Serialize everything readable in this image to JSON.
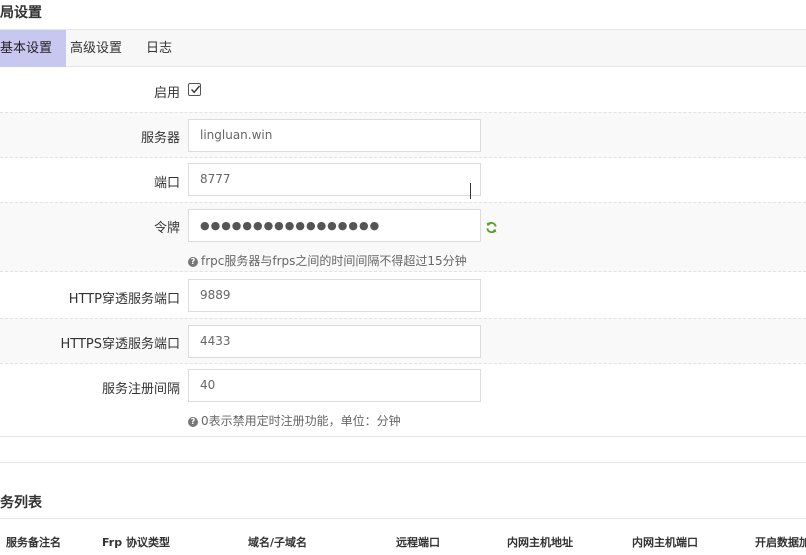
{
  "page": {
    "section_title": "局设置"
  },
  "tabs": [
    {
      "label": "基本设置",
      "active": true
    },
    {
      "label": "高级设置",
      "active": false
    },
    {
      "label": "日志",
      "active": false
    }
  ],
  "form": {
    "enable": {
      "label": "启用",
      "checked": true
    },
    "server": {
      "label": "服务器",
      "value": "lingluan.win"
    },
    "port": {
      "label": "端口",
      "value": "8777"
    },
    "token": {
      "label": "令牌",
      "value": "●●●●●●●●●●●●●●●●●",
      "hint": "frpc服务器与frps之间的时间间隔不得超过15分钟"
    },
    "http_port": {
      "label": "HTTP穿透服务端口",
      "value": "9889"
    },
    "https_port": {
      "label": "HTTPS穿透服务端口",
      "value": "4433"
    },
    "register_interval": {
      "label": "服务注册间隔",
      "value": "40",
      "hint": "0表示禁用定时注册功能，单位：分钟"
    }
  },
  "service_list": {
    "title": "务列表",
    "columns": [
      "服务备注名",
      "Frp 协议类型",
      "域名/子域名",
      "远程端口",
      "内网主机地址",
      "内网主机端口",
      "开启数据加"
    ]
  },
  "colors": {
    "active_tab": "#c7c7f0",
    "refresh_icon": "#5aa02c"
  }
}
